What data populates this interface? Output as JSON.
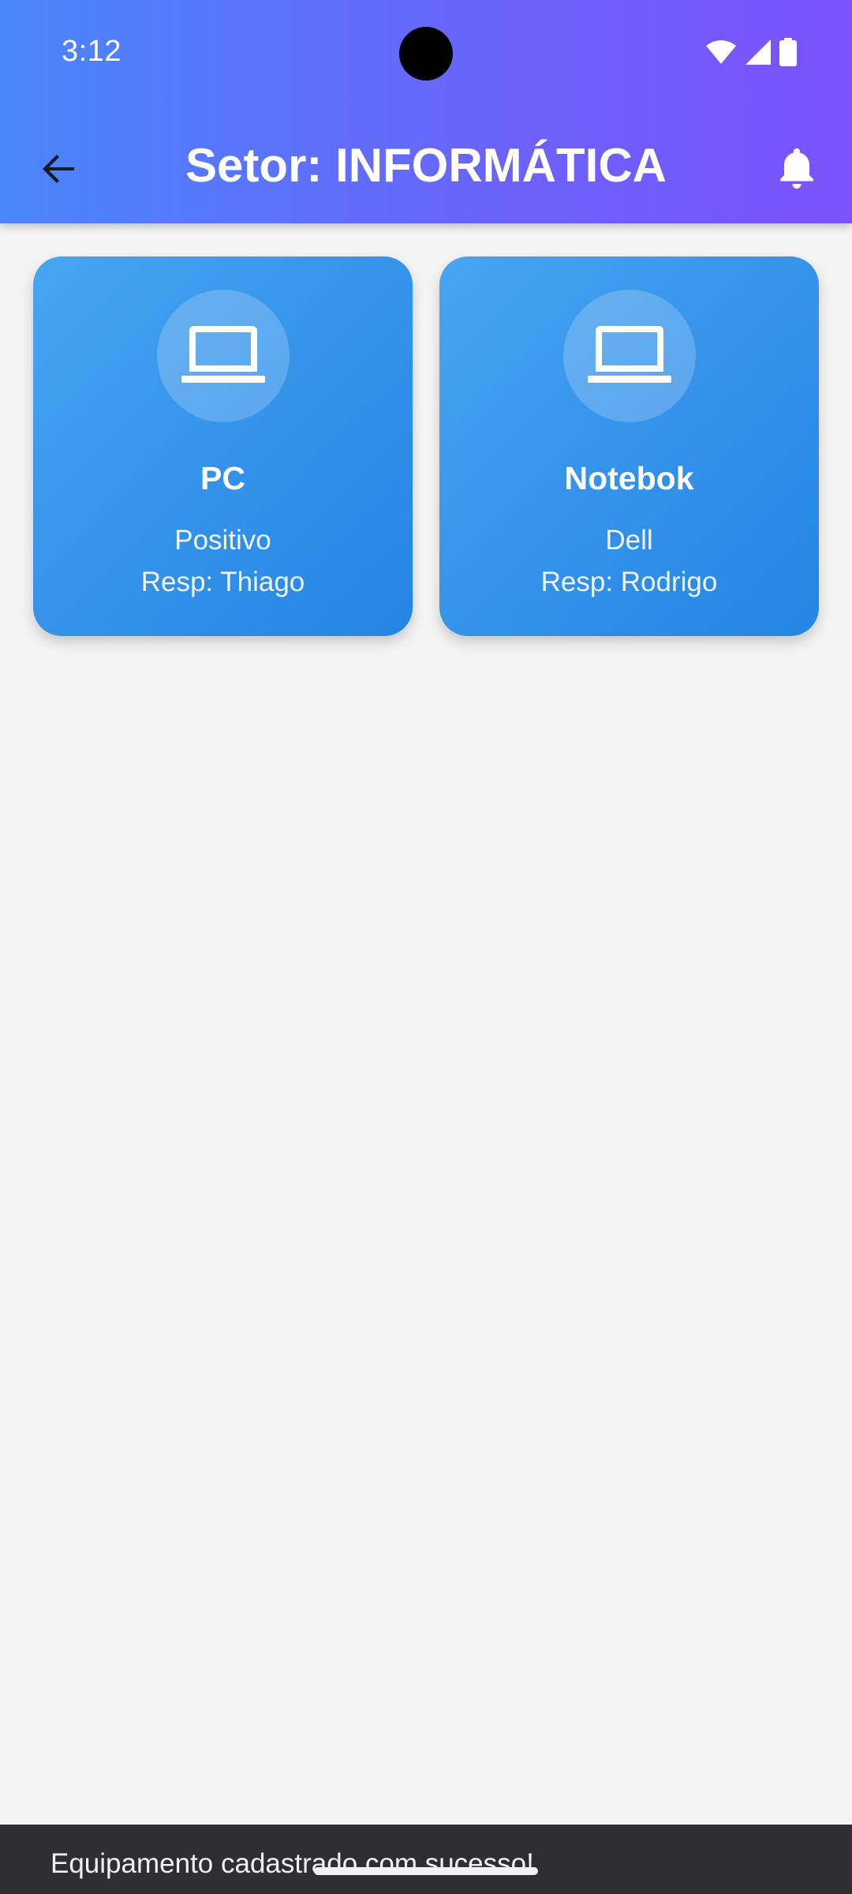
{
  "status_bar": {
    "time": "3:12",
    "icons": [
      "wifi-icon",
      "signal-icon",
      "battery-icon"
    ]
  },
  "app_bar": {
    "title": "Setor: INFORMÁTICA",
    "back_icon": "arrow-back-icon",
    "action_icon": "bell-icon"
  },
  "equipments": [
    {
      "icon": "laptop-icon",
      "name": "PC",
      "brand": "Positivo",
      "responsible": "Resp: Thiago"
    },
    {
      "icon": "laptop-icon",
      "name": "Notebok",
      "brand": "Dell",
      "responsible": "Resp: Rodrigo"
    }
  ],
  "snackbar": {
    "message": "Equipamento cadastrado com sucesso!"
  },
  "colors": {
    "header_gradient_start": "#4a86fb",
    "header_gradient_end": "#7c52fb",
    "card_gradient_start": "#46a6f2",
    "card_gradient_end": "#2585e4",
    "background": "#f4f4f4",
    "snackbar_background": "#2f2e33"
  }
}
